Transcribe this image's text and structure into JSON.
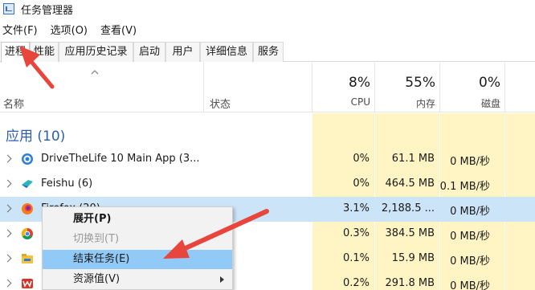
{
  "window": {
    "title": "任务管理器",
    "app_icon": "task-manager-icon"
  },
  "menu": [
    "文件(F)",
    "选项(O)",
    "查看(V)"
  ],
  "tabs": [
    "进程",
    "性能",
    "应用历史记录",
    "启动",
    "用户",
    "详细信息",
    "服务"
  ],
  "active_tab": "进程",
  "columns": {
    "name": "名称",
    "status": "状态",
    "cpu": {
      "percent": "8%",
      "label": "CPU"
    },
    "memory": {
      "percent": "55%",
      "label": "内存"
    },
    "disk": {
      "percent": "0%",
      "label": "磁盘"
    }
  },
  "group": {
    "title": "应用 (10)"
  },
  "processes": [
    {
      "name": "DriveTheLife 10 Main App (3...",
      "cpu": "0%",
      "memory": "61.1 MB",
      "disk": "0 MB/秒",
      "icon": "drivethelife-icon"
    },
    {
      "name": "Feishu (6)",
      "cpu": "0%",
      "memory": "464.5 MB",
      "disk": "0.1 MB/秒",
      "icon": "feishu-icon"
    },
    {
      "name": "Firefox (20)",
      "cpu": "3.1%",
      "memory": "2,188.5 ...",
      "disk": "0 MB/秒",
      "icon": "firefox-icon"
    },
    {
      "name": "",
      "cpu": "0.3%",
      "memory": "384.5 MB",
      "disk": "0 MB/秒",
      "icon": "chrome-icon"
    },
    {
      "name": "",
      "cpu": "0.1%",
      "memory": "15.9 MB",
      "disk": "0 MB/秒",
      "icon": "file-explorer-icon"
    },
    {
      "name": "",
      "cpu": "0.2%",
      "memory": "291.8 MB",
      "disk": "0 MB/秒",
      "icon": "wps-icon"
    }
  ],
  "context_menu": [
    {
      "label": "展开(P)"
    },
    {
      "label": "切换到(T)"
    },
    {
      "label": "结束任务(E)"
    },
    {
      "label": "资源值(V)"
    }
  ],
  "colors": {
    "accent": "#2c5fa8",
    "selection": "#cce4f7",
    "heat": "#fff4c4",
    "annotation_arrow": "#e8453c"
  }
}
